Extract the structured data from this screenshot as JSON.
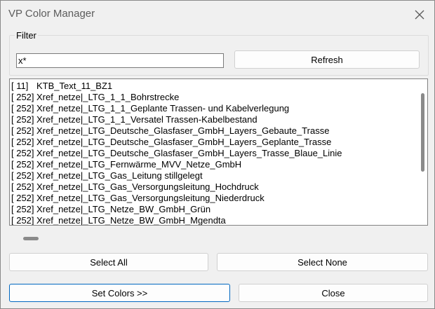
{
  "window": {
    "title": "VP Color Manager"
  },
  "filter": {
    "group_label": "Filter",
    "value": "x*",
    "refresh_label": "Refresh"
  },
  "layers": [
    {
      "num": "[ 11]",
      "name": "KTB_Text_11_BZ1"
    },
    {
      "num": "[ 252]",
      "name": "Xref_netze|_LTG_1_1_Bohrstrecke"
    },
    {
      "num": "[ 252]",
      "name": "Xref_netze|_LTG_1_1_Geplante Trassen- und Kabelverlegung"
    },
    {
      "num": "[ 252]",
      "name": "Xref_netze|_LTG_1_1_Versatel Trassen-Kabelbestand"
    },
    {
      "num": "[ 252]",
      "name": "Xref_netze|_LTG_Deutsche_Glasfaser_GmbH_Layers_Gebaute_Trasse"
    },
    {
      "num": "[ 252]",
      "name": "Xref_netze|_LTG_Deutsche_Glasfaser_GmbH_Layers_Geplante_Trasse"
    },
    {
      "num": "[ 252]",
      "name": "Xref_netze|_LTG_Deutsche_Glasfaser_GmbH_Layers_Trasse_Blaue_Linie"
    },
    {
      "num": "[ 252]",
      "name": "Xref_netze|_LTG_Fernwärme_MVV_Netze_GmbH"
    },
    {
      "num": "[ 252]",
      "name": "Xref_netze|_LTG_Gas_Leitung stillgelegt"
    },
    {
      "num": "[ 252]",
      "name": "Xref_netze|_LTG_Gas_Versorgungsleitung_Hochdruck"
    },
    {
      "num": "[ 252]",
      "name": "Xref_netze|_LTG_Gas_Versorgungsleitung_Niederdruck"
    },
    {
      "num": "[ 252]",
      "name": "Xref_netze|_LTG_Netze_BW_GmbH_Grün"
    },
    {
      "num": "[ 252]",
      "name": "Xref_netze|_LTG_Netze_BW_GmbH_Mgendta"
    }
  ],
  "buttons": {
    "select_all": "Select All",
    "select_none": "Select None",
    "set_colors": "Set Colors >>",
    "close": "Close"
  },
  "colors": {
    "accent": "#0067c0",
    "background": "#f0f0f0"
  }
}
